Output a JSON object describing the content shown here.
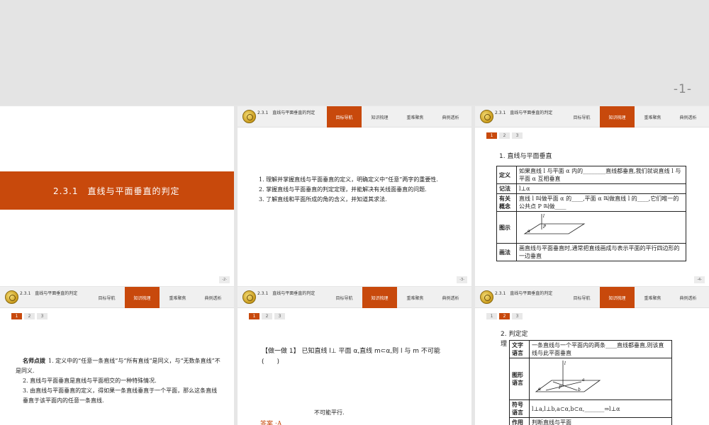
{
  "page_label": "-1-",
  "brand": {
    "accent": "#c8490c"
  },
  "header": {
    "title": "2.3.1　直线与平面垂直的判定",
    "tabs": [
      "目标导航",
      "知识梳理",
      "重难聚焦",
      "典例透析"
    ]
  },
  "pager": [
    "1",
    "2",
    "3"
  ],
  "slide1": {
    "title": "2.3.1　直线与平面垂直的判定",
    "page": "-2-"
  },
  "slide2": {
    "page": "-3-",
    "items": [
      "1. 理解并掌握直线与平面垂直的定义，明确定义中“任意”两字的重要性.",
      "2. 掌握直线与平面垂直的判定定理，并能解决有关线面垂直的问题.",
      "3. 了解直线和平面所成的角的含义，并知道其求法."
    ]
  },
  "slide3": {
    "page": "-4-",
    "heading": "1. 直线与平面垂直",
    "rows": [
      {
        "label": "定义",
        "text": "如果直线 l 与平面 α 内的________直线都垂直,我们就说直线 l 与平面 α 互相垂直"
      },
      {
        "label": "记法",
        "text": "l⊥α"
      },
      {
        "label": "有关概念",
        "text": "直线 l 叫做平面 α 的____,平面 α 叫做直线 l 的____,它们唯一的公共点 P 叫做____"
      },
      {
        "label": "图示",
        "text": ""
      },
      {
        "label": "画法",
        "text": "画直线与平面垂直时,通常把直线画成与表示平面的平行四边形的一边垂直"
      }
    ],
    "figure": {
      "line": "l",
      "plane": "α",
      "point": "P"
    }
  },
  "slide4": {
    "lead": "名师点拨",
    "items": [
      "1. 定义中的“任意一条直线”与“所有直线”是同义，与“无数条直线”不是同义.",
      "2. 直线与平面垂直是直线与平面相交的一种特殊情况.",
      "3. 由直线与平面垂直的定义，得如果一条直线垂直于一个平面，那么这条直线垂直于该平面内的任意一条直线."
    ]
  },
  "slide5": {
    "question": "【做一做 1】 已知直线 l⊥ 平面 α,直线 m⊂α,则 l 与 m 不可能",
    "blank": "(　　)",
    "fragment": "不可能平行.",
    "answer": "答案 :A"
  },
  "slide6": {
    "heading": "2. 判定定理",
    "rows": [
      {
        "label": "文字语言",
        "text": "一条直线与一个平面内的两条____直线都垂直,则该直线与此平面垂直"
      },
      {
        "label": "图形语言",
        "text": ""
      },
      {
        "label": "符号语言",
        "text": "l⊥a,l⊥b,a⊂α,b⊂α,_______⇒l⊥α"
      },
      {
        "label": "作用",
        "text": "判断直线与平面"
      }
    ],
    "figure": {
      "line": "l",
      "plane": "α",
      "a": "a",
      "b": "b",
      "point": "P"
    }
  }
}
